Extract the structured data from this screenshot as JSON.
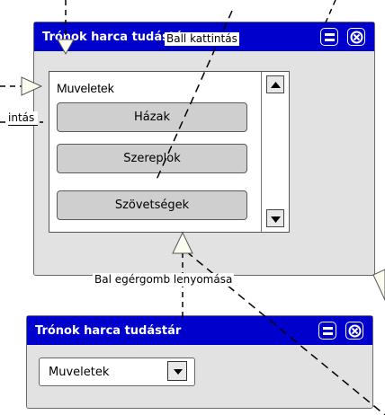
{
  "main_window": {
    "title": "Trónok harca tudástár",
    "panel": {
      "header": "Muveletek",
      "buttons": [
        "Házak",
        "Szereplok",
        "Szövetségek"
      ]
    }
  },
  "second_window": {
    "title": "Trónok harca tudástár",
    "dropdown_value": "Muveletek"
  },
  "transition_labels": {
    "top": "Ball kattintás",
    "left": "intás",
    "bottom": "Bal egérgomb lenyomása"
  },
  "icons": {
    "minimize": "minimize-icon",
    "close": "close-icon",
    "scroll_up": "arrow-up-icon",
    "scroll_down": "arrow-down-icon",
    "dropdown": "chevron-down-icon",
    "arrowhead": "open-triangle-arrowhead-icon"
  },
  "colors": {
    "titlebar": "#0000cc",
    "window_bg": "#e2e2e2",
    "button_bg": "#cfcfcf"
  }
}
